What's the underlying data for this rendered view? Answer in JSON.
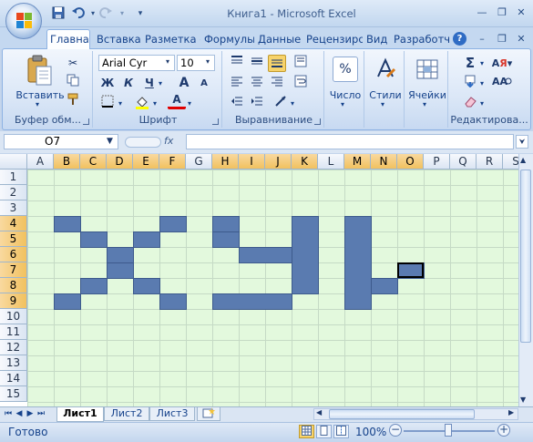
{
  "window": {
    "title": "Книга1 - Microsoft Excel"
  },
  "quick_access": {
    "save_icon": "save-icon",
    "undo_icon": "undo-icon",
    "redo_icon": "redo-icon",
    "customize_icon": "chevron-down-icon"
  },
  "ribbon": {
    "tabs": [
      {
        "label": "Главная",
        "active": true
      },
      {
        "label": "Вставка"
      },
      {
        "label": "Разметка с"
      },
      {
        "label": "Формулы"
      },
      {
        "label": "Данные"
      },
      {
        "label": "Рецензиро"
      },
      {
        "label": "Вид"
      },
      {
        "label": "Разработч"
      }
    ],
    "groups": {
      "clipboard": {
        "label": "Буфер обм...",
        "paste_label": "Вставить"
      },
      "font": {
        "label": "Шрифт",
        "font_name": "Arial Cyr",
        "font_size": "10"
      },
      "alignment": {
        "label": "Выравнивание"
      },
      "number": {
        "label": "Число"
      },
      "styles": {
        "label": "Стили"
      },
      "cells": {
        "label": "Ячейки"
      },
      "editing": {
        "label": "Редактирова..."
      }
    },
    "font_buttons": {
      "bold": "Ж",
      "italic": "К",
      "underline": "Ч",
      "grow": "A",
      "shrink": "A",
      "font_color": "A"
    }
  },
  "formula_bar": {
    "name_box": "O7",
    "fx_label": "fx",
    "formula": ""
  },
  "grid": {
    "columns": [
      "A",
      "B",
      "C",
      "D",
      "E",
      "F",
      "G",
      "H",
      "I",
      "J",
      "K",
      "L",
      "M",
      "N",
      "O",
      "P",
      "Q",
      "R",
      "S"
    ],
    "rows": [
      "1",
      "2",
      "3",
      "4",
      "5",
      "6",
      "7",
      "8",
      "9",
      "10",
      "11",
      "12",
      "13",
      "14",
      "15"
    ],
    "selected_cell": "O7",
    "fill_color": "#5a7bb0",
    "sheet_background": "#e3f9dd"
  },
  "sheets": {
    "tabs": [
      {
        "label": "Лист1",
        "active": true
      },
      {
        "label": "Лист2"
      },
      {
        "label": "Лист3"
      }
    ]
  },
  "status": {
    "ready": "Готово",
    "zoom": "100%"
  }
}
